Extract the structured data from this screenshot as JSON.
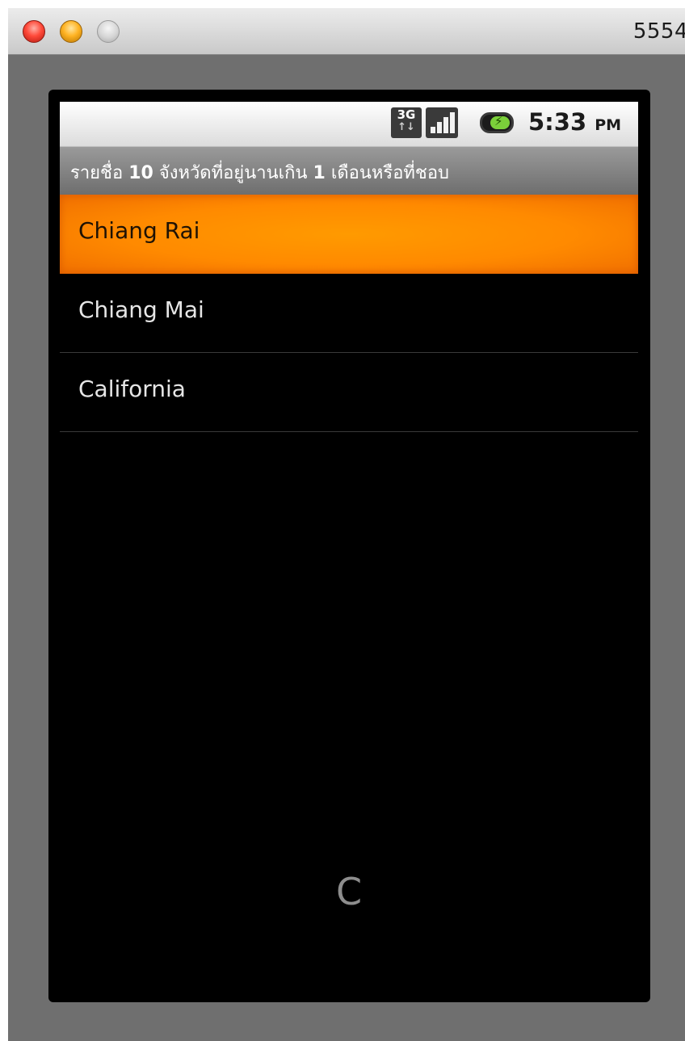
{
  "window": {
    "title": "5554"
  },
  "status_bar": {
    "network": "3G",
    "time": "5:33",
    "ampm": "PM",
    "icons": [
      "3g-data-icon",
      "signal-icon",
      "battery-charging-icon"
    ]
  },
  "app": {
    "title_parts": [
      "รายชื่อ ",
      "10",
      " จังหวัดที่อยู่นานเกิน ",
      "1",
      " เดือนหรือที่ชอบ"
    ],
    "items": [
      {
        "label": "Chiang Rai",
        "selected": true
      },
      {
        "label": "Chiang Mai",
        "selected": false
      },
      {
        "label": "California",
        "selected": false
      }
    ],
    "fast_scroll_letter": "C"
  },
  "colors": {
    "selected_item": "#ff8a00",
    "screen_background": "#000000",
    "title_bar": "#808080"
  }
}
